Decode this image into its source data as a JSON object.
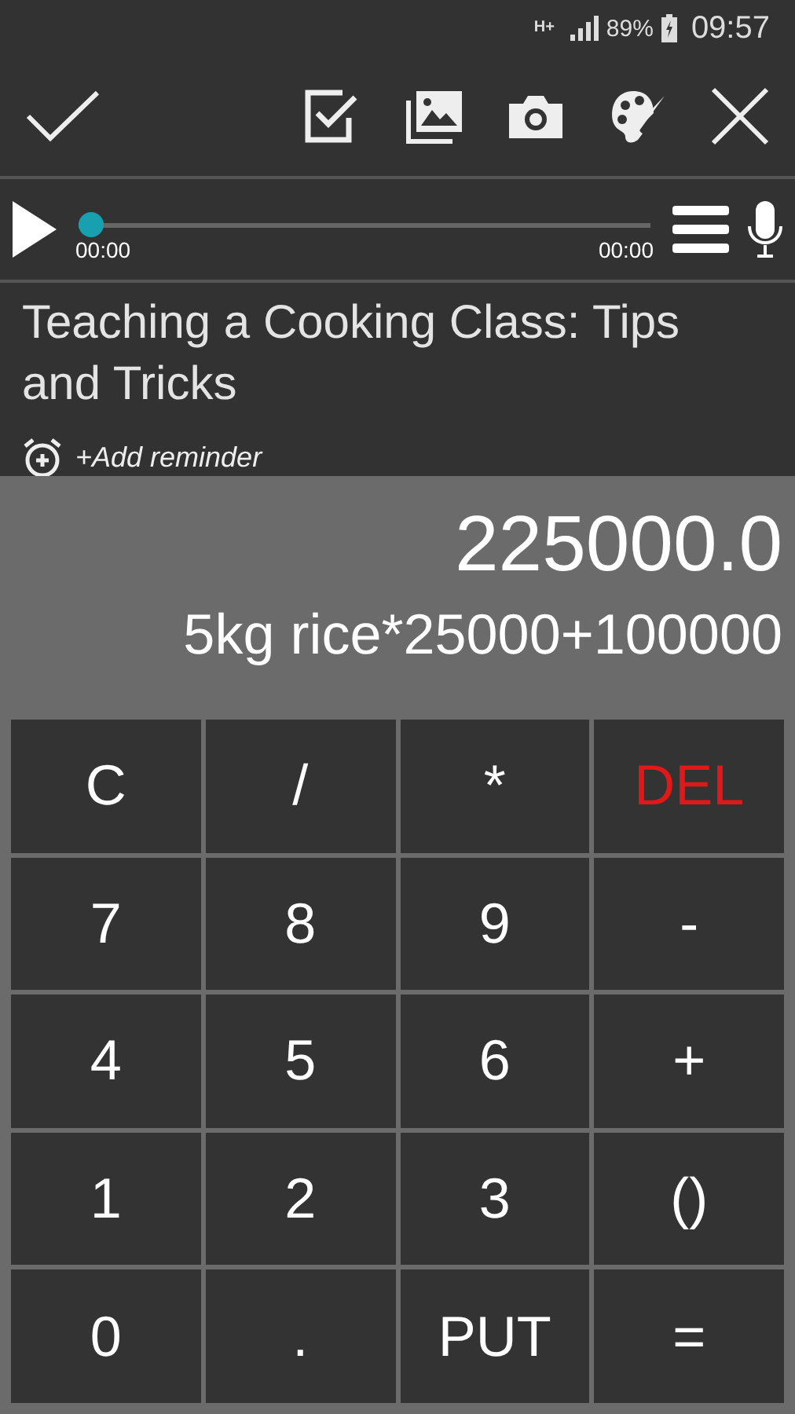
{
  "status_bar": {
    "network": "H+",
    "battery": "89%",
    "time": "09:57"
  },
  "player": {
    "level": 0,
    "elapsed": "00:00",
    "duration": "00:00"
  },
  "note": {
    "title": "Teaching a Cooking Class: Tips and Tricks",
    "reminder": "+Add reminder"
  },
  "calculator": {
    "result": "225000.0",
    "expression": "5kg rice*25000+100000",
    "keys": [
      {
        "label": "C",
        "kind": "normal"
      },
      {
        "label": "/",
        "kind": "normal"
      },
      {
        "label": "*",
        "kind": "normal"
      },
      {
        "label": "DEL",
        "kind": "delete"
      },
      {
        "label": "7",
        "kind": "normal"
      },
      {
        "label": "8",
        "kind": "normal"
      },
      {
        "label": "9",
        "kind": "normal"
      },
      {
        "label": "-",
        "kind": "normal"
      },
      {
        "label": "4",
        "kind": "normal"
      },
      {
        "label": "5",
        "kind": "normal"
      },
      {
        "label": "6",
        "kind": "normal"
      },
      {
        "label": "+",
        "kind": "normal"
      },
      {
        "label": "1",
        "kind": "normal"
      },
      {
        "label": "2",
        "kind": "normal"
      },
      {
        "label": "3",
        "kind": "normal"
      },
      {
        "label": "()",
        "kind": "normal"
      },
      {
        "label": "0",
        "kind": "normal"
      },
      {
        "label": ".",
        "kind": "normal"
      },
      {
        "label": "PUT",
        "kind": "normal"
      },
      {
        "label": "=",
        "kind": "normal"
      }
    ]
  }
}
